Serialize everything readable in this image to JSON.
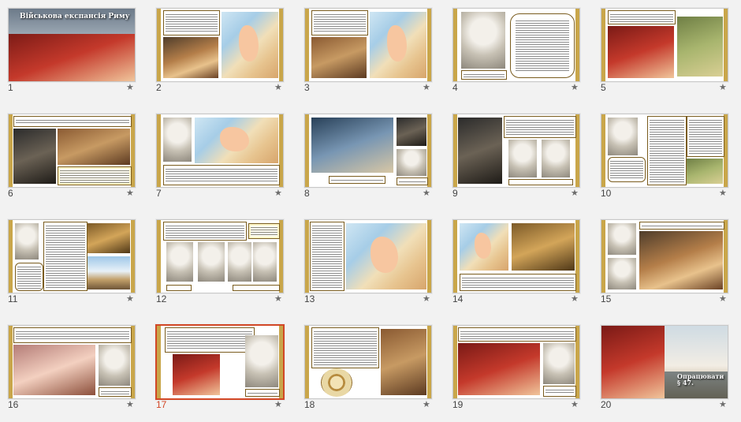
{
  "view": "slide-sorter",
  "accent_color": "#d24726",
  "selected_slide": "17",
  "slides": [
    {
      "number": "1",
      "title": "Військова експансія Риму",
      "icon": "star-icon"
    },
    {
      "number": "2",
      "icon": "star-icon"
    },
    {
      "number": "3",
      "icon": "star-icon"
    },
    {
      "number": "4",
      "icon": "star-icon"
    },
    {
      "number": "5",
      "icon": "star-icon"
    },
    {
      "number": "6",
      "icon": "star-icon"
    },
    {
      "number": "7",
      "icon": "star-icon"
    },
    {
      "number": "8",
      "icon": "star-icon"
    },
    {
      "number": "9",
      "icon": "star-icon"
    },
    {
      "number": "10",
      "icon": "star-icon"
    },
    {
      "number": "11",
      "icon": "star-icon"
    },
    {
      "number": "12",
      "icon": "star-icon"
    },
    {
      "number": "13",
      "icon": "star-icon"
    },
    {
      "number": "14",
      "icon": "star-icon"
    },
    {
      "number": "15",
      "icon": "star-icon"
    },
    {
      "number": "16",
      "icon": "star-icon"
    },
    {
      "number": "17",
      "icon": "star-icon"
    },
    {
      "number": "18",
      "icon": "star-icon"
    },
    {
      "number": "19",
      "icon": "star-icon"
    },
    {
      "number": "20",
      "title": "Опрацювати § 47.",
      "icon": "star-icon"
    }
  ]
}
